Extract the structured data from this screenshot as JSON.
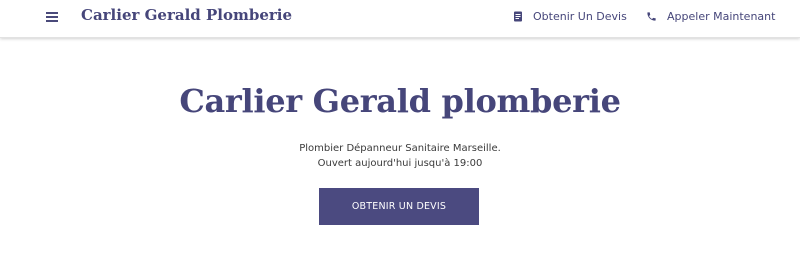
{
  "header": {
    "site_title": "Carlier Gerald Plomberie",
    "menu_icon": "hamburger-menu-icon",
    "nav": {
      "quote": {
        "label": "Obtenir Un Devis",
        "icon": "document-icon"
      },
      "call": {
        "label": "Appeler Maintenant",
        "icon": "phone-icon"
      }
    }
  },
  "hero": {
    "title": "Carlier Gerald plomberie",
    "subtitle_line1": "Plombier Dépanneur Sanitaire Marseille.",
    "subtitle_line2": "Ouvert aujourd'hui jusqu'à 19:00",
    "cta_label": "OBTENIR UN DEVIS"
  },
  "colors": {
    "brand": "#46467a",
    "cta_background": "#4b4a80",
    "cta_text": "#ffffff",
    "page_background": "#ffffff"
  }
}
